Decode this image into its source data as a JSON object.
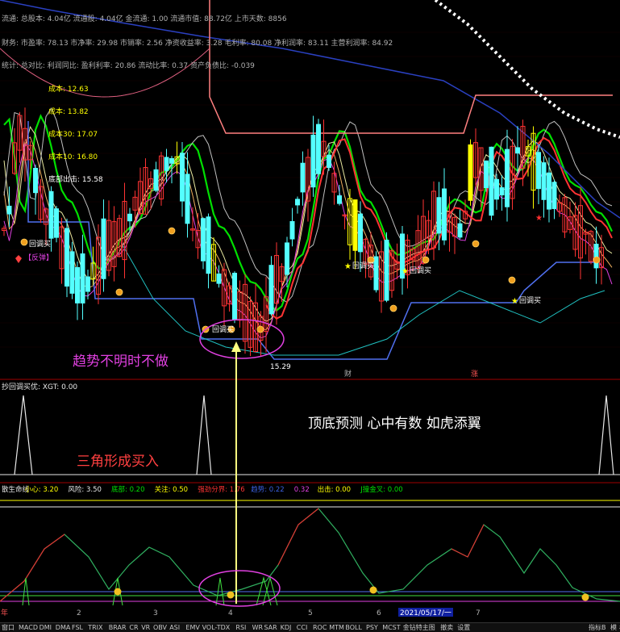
{
  "colors": {
    "bg": "#000000",
    "up": "#FF3333",
    "down": "#54FFFF",
    "yellow": "#FFFF00",
    "magenta": "#E040E0",
    "green": "#00E000",
    "blue": "#3A60E0",
    "white": "#E8E8E8",
    "salmon": "#FF8080",
    "teal": "#20C0C0",
    "panel_line": "#A00000"
  },
  "main_panel": {
    "info_lines": [
      "流通: 总股本: 4.04亿 流通股: 4.04亿 金流通: 1.00 流通市值: 88.72亿 上市天数: 8856",
      "财务: 市盈率: 78.13 市净率: 29.98 市销率: 2.56 净资收益率: 3.28 毛利率: 80.08 净利润率: 83.11 主营利润率: 84.92",
      "统计: 总对比: 利润同比: 盈利利率: 20.86 流动比率: 0.37 资产负债比: -0.039"
    ],
    "cost_labels": [
      "成本: 12.63",
      "成本: 13.82",
      "成本30: 17.07",
      "成本10: 16.80",
      "底部出击: 15.58"
    ],
    "buy_labels": [
      "回调买",
      "回调买",
      "回调买",
      "回调买",
      "回调买"
    ],
    "sell_label": "【反弹】",
    "low_label": "15.29",
    "annotation": "趋势不明时不做",
    "markers": [
      "财",
      "涨"
    ]
  },
  "mid_panel": {
    "header": "抄回调买优: XGT: 0.00",
    "slogan": "顶底预测  心中有数  如虎添翼",
    "annotation": "三角形成买入"
  },
  "bottom_panel": {
    "header_items": [
      {
        "text": "散生命线",
        "color": "#E8E8E8"
      },
      {
        "text": "小心: 3.20",
        "color": "#FFFF00"
      },
      {
        "text": "风险: 3.50",
        "color": "#E8E8E8"
      },
      {
        "text": "底部: 0.20",
        "color": "#00E000"
      },
      {
        "text": "关注: 0.50",
        "color": "#FFFF00"
      },
      {
        "text": "强劲分界: 1.76",
        "color": "#FF3333"
      },
      {
        "text": "趋势: 0.22",
        "color": "#3A60E0"
      },
      {
        "text": "0.32",
        "color": "#E040E0"
      },
      {
        "text": "出击: 0.00",
        "color": "#FFFF00"
      },
      {
        "text": "J撞金叉: 0.00",
        "color": "#00E000"
      }
    ],
    "date_label": "2021/05/17/一",
    "axis_labels": [
      "2",
      "3",
      "4",
      "5",
      "6",
      "7"
    ],
    "left_label": "年"
  },
  "tabs": [
    "窗口",
    "MACD",
    "DMI",
    "DMA",
    "FSL",
    "TRIX",
    "BRAR",
    "CR",
    "VR",
    "OBV",
    "ASI",
    "EMV",
    "VOL-TDX",
    "RSI",
    "WR",
    "SAR",
    "KDJ",
    "CCI",
    "ROC",
    "MTM",
    "BOLL",
    "PSY",
    "MCST",
    "金钻特主图",
    "撤卖",
    "设置"
  ],
  "right_tabs": [
    "指标B",
    "模",
    "板"
  ],
  "chart_data": {
    "type": "candlestick",
    "title": "",
    "price_range": [
      15.29,
      25.0
    ],
    "low_price": 15.29,
    "cost_lines": [
      {
        "label": "成本",
        "value": 12.63
      },
      {
        "label": "成本",
        "value": 13.82
      },
      {
        "label": "成本30",
        "value": 17.07
      },
      {
        "label": "成本10",
        "value": 16.8
      },
      {
        "label": "底部出击",
        "value": 15.58
      }
    ],
    "oscillator_levels": {
      "小心": 3.2,
      "风险": 3.5,
      "底部": 0.2,
      "关注": 0.5,
      "强劲分界": 1.76,
      "趋势": 0.22
    },
    "triangle_signals": 3
  }
}
